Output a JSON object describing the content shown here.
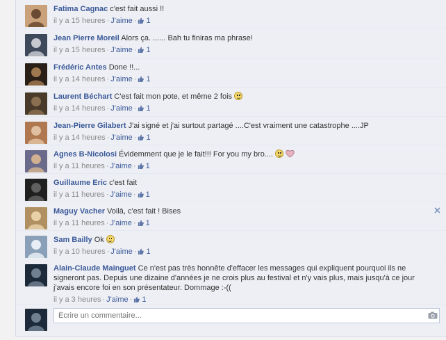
{
  "comments": [
    {
      "author": "Fatima Cagnac",
      "text": "c'est fait aussi !!",
      "time": "il y a 15 heures",
      "like_label": "J'aime",
      "likes": "1",
      "avatar_colors": [
        "#c9a27b",
        "#6b4a33"
      ]
    },
    {
      "author": "Jean Pierre Moreil",
      "text": "Alors ça. ...... Bah tu finiras ma phrase!",
      "time": "il y a 15 heures",
      "like_label": "J'aime",
      "likes": "1",
      "avatar_colors": [
        "#3e4a5c",
        "#c8c8d0"
      ]
    },
    {
      "author": "Frédéric Antes",
      "text": "Done !!...",
      "time": "il y a 14 heures",
      "like_label": "J'aime",
      "likes": "1",
      "avatar_colors": [
        "#2a2018",
        "#a07850"
      ]
    },
    {
      "author": "Laurent Béchart",
      "text": "C'est fait mon pote, et même 2 fois",
      "time": "il y a 14 heures",
      "like_label": "J'aime",
      "likes": "1",
      "smiley": true,
      "avatar_colors": [
        "#4a3a2a",
        "#8a7050"
      ]
    },
    {
      "author": "Jean-Pierre Gilabert",
      "text": "J'ai signé et j'ai surtout partagé ....C'est vraiment une catastrophe ....JP",
      "time": "il y a 14 heures",
      "like_label": "J'aime",
      "likes": "1",
      "avatar_colors": [
        "#b07850",
        "#e0c0a0"
      ]
    },
    {
      "author": "Agnes B-Nicolosi",
      "text": "Évidemment que je le fait!!! For you my bro....",
      "time": "il y a 11 heures",
      "like_label": "J'aime",
      "likes": "1",
      "smiley": true,
      "heart": true,
      "avatar_colors": [
        "#6a6a8a",
        "#d0b090"
      ]
    },
    {
      "author": "Guillaume Eric",
      "text": "c'est fait",
      "time": "il y a 11 heures",
      "like_label": "J'aime",
      "likes": "1",
      "avatar_colors": [
        "#202020",
        "#606060"
      ]
    },
    {
      "author": "Maguy Vacher",
      "text": "Voilà, c'est fait ! Bises",
      "time": "il y a 11 heures",
      "like_label": "J'aime",
      "likes": "1",
      "close": true,
      "avatar_colors": [
        "#b09060",
        "#e8d0a8"
      ]
    },
    {
      "author": "Sam Bailly",
      "text": "Ok",
      "time": "il y a 10 heures",
      "like_label": "J'aime",
      "likes": "1",
      "smiley": true,
      "avatar_colors": [
        "#8aa0b8",
        "#e8eef5"
      ]
    },
    {
      "author": "Alain-Claude Mainguet",
      "text": "Ce n'est pas très honnête d'effacer les messages qui expliquent pourquoi ils ne signeront pas. Depuis une dizaine d'années je ne crois plus au festival et n'y vais plus, mais jusqu'à ce jour j'avais encore foi en son présentateur. Dommage :-((",
      "time": "il y a 3 heures",
      "like_label": "J'aime",
      "likes": "1",
      "avatar_colors": [
        "#1c2a3a",
        "#708090"
      ]
    }
  ],
  "composer": {
    "placeholder": "Écrire un commentaire...",
    "avatar_colors": [
      "#1c2a3a",
      "#708090"
    ]
  },
  "icons": {
    "like": "thumbs-up-icon",
    "close": "close-icon",
    "camera": "camera-icon",
    "smiley": "smiley-icon",
    "heart": "heart-icon"
  },
  "colors": {
    "link": "#3b5998",
    "meta": "#8a8a8a",
    "panel": "#edeff4"
  }
}
